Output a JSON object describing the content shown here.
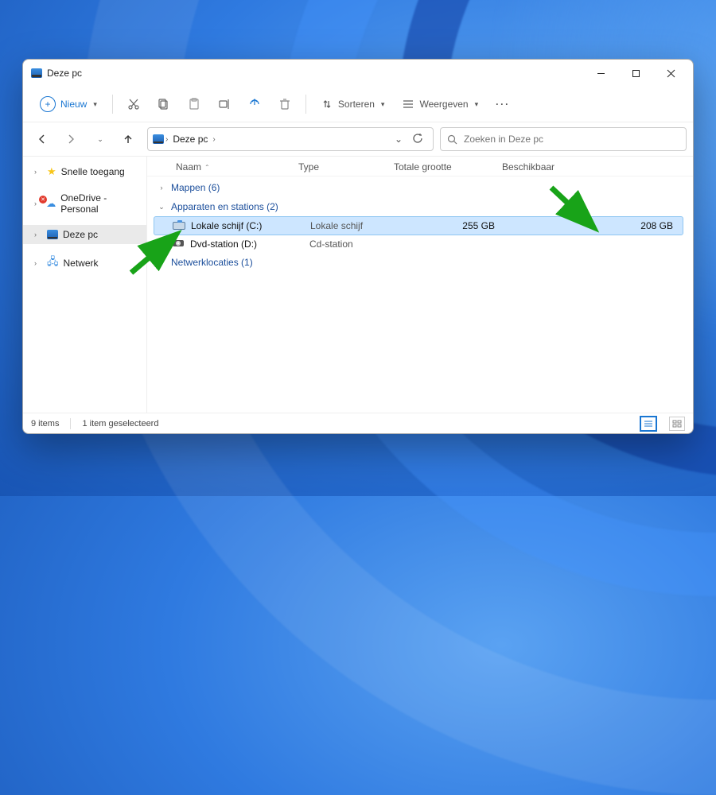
{
  "window": {
    "title": "Deze pc"
  },
  "toolbar": {
    "new_label": "Nieuw",
    "sort_label": "Sorteren",
    "view_label": "Weergeven"
  },
  "address": {
    "crumb_root": "Deze pc"
  },
  "search": {
    "placeholder": "Zoeken in Deze pc"
  },
  "sidebar": {
    "items": [
      {
        "label": "Snelle toegang"
      },
      {
        "label": "OneDrive - Personal"
      },
      {
        "label": "Deze pc"
      },
      {
        "label": "Netwerk"
      }
    ]
  },
  "columns": {
    "name": "Naam",
    "type": "Type",
    "total": "Totale grootte",
    "available": "Beschikbaar"
  },
  "groups": {
    "folders": "Mappen (6)",
    "devices": "Apparaten en stations (2)",
    "network": "Netwerklocaties (1)"
  },
  "rows": [
    {
      "name": "Lokale schijf (C:)",
      "type": "Lokale schijf",
      "total": "255 GB",
      "available": "208 GB"
    },
    {
      "name": "Dvd-station (D:)",
      "type": "Cd-station",
      "total": "",
      "available": ""
    }
  ],
  "status": {
    "count": "9 items",
    "selected": "1 item geselecteerd"
  }
}
